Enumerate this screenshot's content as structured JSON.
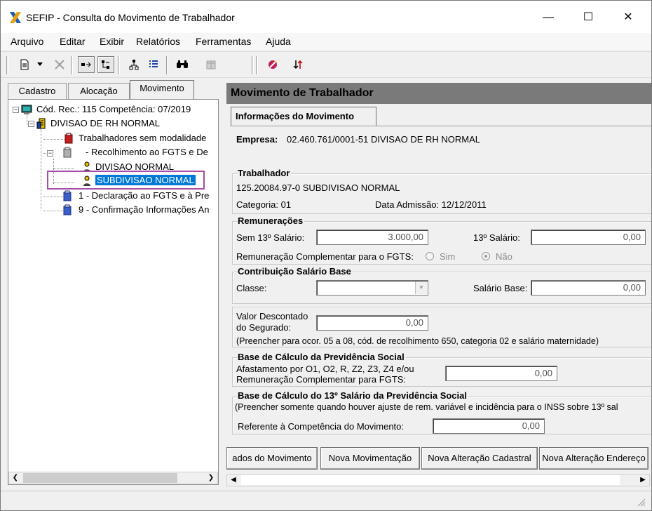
{
  "window": {
    "title": "SEFIP - Consulta do Movimento de Trabalhador",
    "minimize": "—",
    "maximize": "☐",
    "close": "✕"
  },
  "menu": [
    "Arquivo",
    "Editar",
    "Exibir",
    "Relatórios",
    "Ferramentas",
    "Ajuda"
  ],
  "left_tabs": [
    "Cadastro",
    "Alocação",
    "Movimento"
  ],
  "tree": {
    "root": "Cód. Rec.: 115 Competência: 07/2019",
    "company": "DIVISAO DE RH NORMAL",
    "no_modality": "Trabalhadores sem modalidade",
    "fgts": "- Recolhimento ao FGTS e De",
    "division": "DIVISAO NORMAL",
    "subdivision": "SUBDIVISAO NORMAL",
    "declaration": "1 - Declaração ao FGTS e à Pre",
    "confirmation": "9 - Confirmação Informações An"
  },
  "panel": {
    "header": "Movimento de Trabalhador",
    "tab": "Informações do Movimento",
    "empresa_label": "Empresa:",
    "empresa_value": "02.460.761/0001-51  DIVISAO DE RH NORMAL",
    "trabalhador": {
      "title": "Trabalhador",
      "id": "125.20084.97-0 SUBDIVISAO NORMAL",
      "categoria": "Categoria: 01",
      "admissao": "Data Admissão: 12/12/2011"
    },
    "remuneracoes": {
      "title": "Remunerações",
      "sem13_label": "Sem 13º Salário:",
      "sem13_value": "3.000,00",
      "s13_label": "13º Salário:",
      "s13_value": "0,00",
      "complementar_label": "Remuneração Complementar para o FGTS:",
      "sim": "Sim",
      "nao": "Não"
    },
    "contribuicao": {
      "title": "Contribuição Salário Base",
      "classe_label": "Classe:",
      "classe_value": "",
      "salario_label": "Salário Base:",
      "salario_value": "0,00"
    },
    "descontado": {
      "label1": "Valor Descontado",
      "label2": "do Segurado:",
      "value": "0,00",
      "note": "(Preencher para ocor. 05 a 08, cód. de recolhimento 650, categoria 02 e salário maternidade)"
    },
    "base_prev": {
      "title": "Base de Cálculo da Previdência Social",
      "label1": "Afastamento por O1, O2, R, Z2, Z3, Z4 e/ou",
      "label2": "Remuneração Complementar para FGTS:",
      "value": "0,00"
    },
    "base_13": {
      "title": "Base de Cálculo do 13º Salário da Previdência Social",
      "note": "(Preencher somente quando houver ajuste de rem. variável e incidência para o INSS sobre 13º sal",
      "ref_label": "Referente à Competência do Movimento:",
      "ref_value": "0,00"
    },
    "buttons": [
      "ados do Movimento",
      "Nova Movimentação",
      "Nova Alteração Cadastral",
      "Nova Alteração Endereço"
    ]
  },
  "colors": {
    "header_bg": "#7a7a7a",
    "selection": "#0078d7",
    "highlight": "#a64ca6"
  }
}
